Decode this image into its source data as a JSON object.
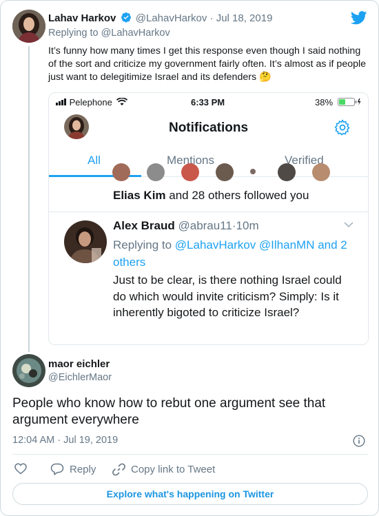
{
  "tweet1": {
    "name": "Lahav Harkov",
    "handle": "@LahavHarkov",
    "sep": " · ",
    "date": "Jul 18, 2019",
    "replying_prefix": "Replying to ",
    "replying_to": "@LahavHarkov",
    "body": "It’s funny how many times I get this response even though I said nothing of the sort and criticize my government fairly often. It’s almost as if people just want to delegitimize Israel and its defenders 🤔"
  },
  "screenshot": {
    "status_bar": {
      "carrier": "Pelephone",
      "time": "6:33 PM",
      "battery": "38%"
    },
    "title": "Notifications",
    "tabs": [
      "All",
      "Mentions",
      "Verified"
    ],
    "active_tab": "All",
    "follow_notice": {
      "name": "Elias Kim",
      "rest": " and 28 others followed you"
    },
    "reply": {
      "name": "Alex Braud",
      "handle": "@abrau11",
      "dot": "·",
      "age": "10m",
      "replying_prefix": "Replying to ",
      "replying_to": "@LahavHarkov @IlhanMN and 2 others",
      "body": "Just to be clear, is there nothing Israel could do which would invite criticism? Simply: Is it inherently bigoted to criticize Israel?"
    }
  },
  "tweet2": {
    "name": "maor eichler",
    "handle": "@EichlerMaor",
    "body": "People who know how to rebut one argument see that argument everywhere",
    "time": "12:04 AM · Jul 19, 2019"
  },
  "actions": {
    "reply_label": "Reply",
    "copy_label": "Copy link to Tweet"
  },
  "explore_label": "Explore what's happening on Twitter",
  "colors": {
    "accent": "#1da1f2",
    "link": "#1b95e0",
    "muted": "#657786",
    "text": "#14171a",
    "border": "#cfd9de"
  },
  "icons": [
    "twitter-bird-icon",
    "verified-badge-icon",
    "wifi-icon",
    "battery-icon",
    "settings-gear-icon",
    "chevron-down-icon",
    "info-icon",
    "heart-icon",
    "reply-icon",
    "link-icon"
  ]
}
